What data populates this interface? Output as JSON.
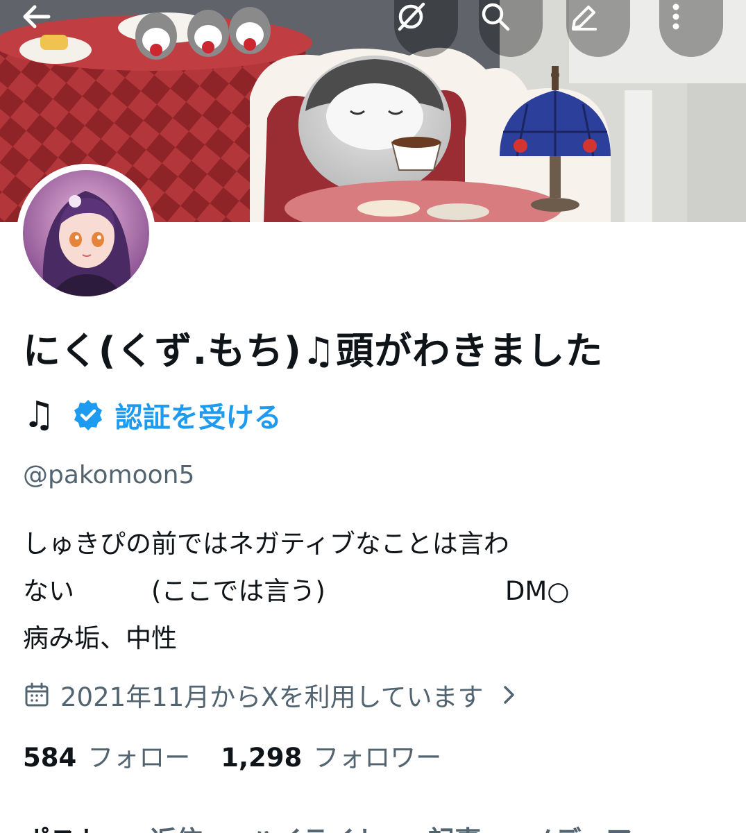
{
  "profile": {
    "name_line1": "にく(くず.もち)♫頭がわきました",
    "name_line2": "♫",
    "verify_label": "認証を受ける",
    "handle": "@pakomoon5",
    "bio_lines": [
      "しゅきぴの前ではネガティブなことは言わ",
      "ない　　　(ここでは言う)　　　　　　　DM○",
      "病み垢、中性"
    ],
    "joined": "2021年11月からXを利用しています",
    "following_count": "584",
    "following_label": "フォロー",
    "followers_count": "1,298",
    "followers_label": "フォロワー"
  },
  "tabs": [
    "ポスト",
    "返信",
    "ハイライト",
    "記事",
    "メディア"
  ],
  "icons": {
    "back": "arrow-left-icon",
    "grok": "grok-icon",
    "search": "search-icon",
    "edit": "edit-icon",
    "more": "more-vertical-icon",
    "verified": "verified-badge-icon",
    "calendar": "calendar-icon",
    "chevron": "chevron-right-icon"
  },
  "colors": {
    "accent": "#1d9bf0",
    "text_primary": "#0f1419",
    "text_secondary": "#536471",
    "background": "#ffffff"
  }
}
